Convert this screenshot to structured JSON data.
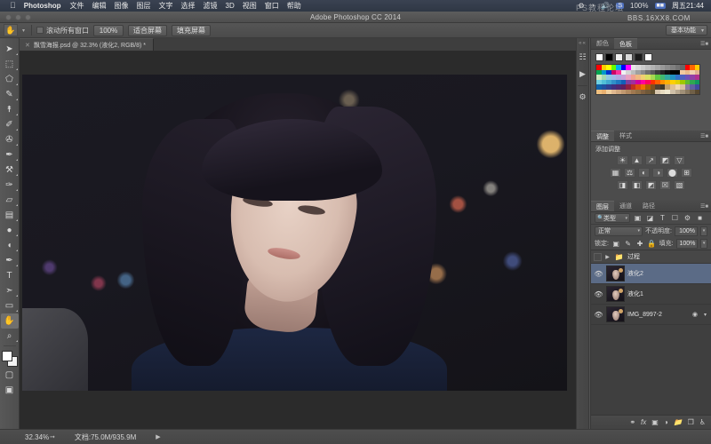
{
  "macbar": {
    "apple_icon": "apple-logo",
    "app_name": "Photoshop",
    "menus": [
      "文件",
      "编辑",
      "图像",
      "图层",
      "文字",
      "选择",
      "滤镜",
      "3D",
      "视图",
      "窗口",
      "帮助"
    ],
    "status_icons": [
      "bluetooth-icon",
      "wifi-icon",
      "volume-icon",
      "scroll-icon"
    ],
    "battery_percent": "100%",
    "battery_icon": "battery-icon",
    "clock": "周五21:44"
  },
  "titlebar": {
    "title": "Adobe Photoshop CC 2014",
    "traffic_lights": [
      "close",
      "minimize",
      "zoom"
    ]
  },
  "options_bar": {
    "tool_icon": "hand-tool-icon",
    "preset_caret": "chevron-down-icon",
    "scroll_all_windows": "滚动所有窗口",
    "buttons": [
      "100%",
      "适合屏幕",
      "填充屏幕"
    ],
    "workspace": "基本功能"
  },
  "document_tab": {
    "label": "飘雪海报.psd @ 32.3% (液化2, RGB/8) *",
    "close_icon": "close-icon"
  },
  "toolbar": {
    "tools": [
      {
        "name": "move-tool",
        "glyph": "➤"
      },
      {
        "name": "marquee-tool",
        "glyph": "⬚"
      },
      {
        "name": "lasso-tool",
        "glyph": "⬠"
      },
      {
        "name": "quick-selection-tool",
        "glyph": "✎"
      },
      {
        "name": "crop-tool",
        "glyph": "⯭"
      },
      {
        "name": "eyedropper-tool",
        "glyph": "✐"
      },
      {
        "name": "healing-brush-tool",
        "glyph": "✇"
      },
      {
        "name": "brush-tool",
        "glyph": "✒"
      },
      {
        "name": "clone-stamp-tool",
        "glyph": "⚒"
      },
      {
        "name": "history-brush-tool",
        "glyph": "✑"
      },
      {
        "name": "eraser-tool",
        "glyph": "▱"
      },
      {
        "name": "gradient-tool",
        "glyph": "▤"
      },
      {
        "name": "blur-tool",
        "glyph": "●"
      },
      {
        "name": "dodge-tool",
        "glyph": "◖"
      },
      {
        "name": "pen-tool",
        "glyph": "✒"
      },
      {
        "name": "type-tool",
        "glyph": "T"
      },
      {
        "name": "path-selection-tool",
        "glyph": "➤"
      },
      {
        "name": "shape-tool",
        "glyph": "▭"
      },
      {
        "name": "hand-tool",
        "glyph": "✋",
        "selected": true
      },
      {
        "name": "zoom-tool",
        "glyph": "⌕"
      }
    ],
    "foreground_color": "#ffffff",
    "background_color": "#f2f2f2",
    "quick_mask_icon": "quick-mask-icon",
    "screen_mode_icon": "screen-mode-icon"
  },
  "color_panel": {
    "tabs": [
      "颜色",
      "色板"
    ],
    "active_tab": "色板",
    "top_swatches": [
      "#ffffff",
      "#000000",
      "#f0f0f0",
      "#d9d9d9",
      "#1a1a1a",
      "#ffffff"
    ],
    "swatches": [
      "#ff0000",
      "#ffcc00",
      "#ffff00",
      "#66ff00",
      "#00b0f0",
      "#0000ff",
      "#ff00ff",
      "#e6e6e6",
      "#d9d9d9",
      "#cccccc",
      "#bfbfbf",
      "#b3b3b3",
      "#a6a6a6",
      "#999999",
      "#8c8c8c",
      "#808080",
      "#737373",
      "#666666",
      "#ff0000",
      "#ff6600",
      "#ffcc00",
      "#00a651",
      "#0099cc",
      "#0033cc",
      "#cc0066",
      "#ff3399",
      "#f2f2f2",
      "#d4d4d4",
      "#bdbdbd",
      "#a0a0a0",
      "#8a8a8a",
      "#6e6e6e",
      "#5a5a5a",
      "#3c3c3c",
      "#262626",
      "#111111",
      "#000000",
      "#000000",
      "#f2c9a0",
      "#e8b98c",
      "#f0d0b0",
      "#e0b090",
      "#cfe8c0",
      "#9fd8b0",
      "#90c8e0",
      "#a0b8e8",
      "#b0a8e0",
      "#c8a0d8",
      "#e8a0c0",
      "#f0a090",
      "#f0b880",
      "#f0d070",
      "#d8e060",
      "#a8d850",
      "#60c840",
      "#40b870",
      "#30a8a0",
      "#2090c0",
      "#3070c8",
      "#5060c0",
      "#7050b8",
      "#9040a8",
      "#b03090",
      "#70d0e0",
      "#50c0d8",
      "#40a8d0",
      "#3090c8",
      "#2078c0",
      "#1060b8",
      "#8040a0",
      "#a030a0",
      "#d000a0",
      "#ff00a0",
      "#ff0060",
      "#ff3000",
      "#ff6000",
      "#ff9000",
      "#ffb000",
      "#ffd000",
      "#e0d000",
      "#a0c800",
      "#60b830",
      "#30a850",
      "#109860",
      "#1060a8",
      "#2050a0",
      "#304090",
      "#403080",
      "#502870",
      "#602060",
      "#902040",
      "#c03020",
      "#e05010",
      "#f07000",
      "#b06000",
      "#805020",
      "#504030",
      "#403828",
      "#c0a070",
      "#e0c090",
      "#f0d8b0",
      "#d8c0a0",
      "#8878a0",
      "#6060a0",
      "#4048a0",
      "#f0c080",
      "#e8b070",
      "#f0d0a0",
      "#e0b890",
      "#d0a880",
      "#c09870",
      "#b08860",
      "#a07850",
      "#907048",
      "#806040",
      "#705838",
      "#605030",
      "#d8c8b0",
      "#e8dcc0",
      "#f0e8d0",
      "#cfc0a8",
      "#b8a890",
      "#a09078",
      "#887860",
      "#706048",
      "#584830"
    ]
  },
  "adjustments_panel": {
    "tabs": [
      "调整",
      "样式"
    ],
    "active_tab": "调整",
    "title": "添加调整",
    "rows": [
      [
        {
          "name": "brightness-contrast-icon",
          "glyph": "☀"
        },
        {
          "name": "levels-icon",
          "glyph": "▲"
        },
        {
          "name": "curves-icon",
          "glyph": "↗"
        },
        {
          "name": "exposure-icon",
          "glyph": "◩"
        },
        {
          "name": "vibrance-icon",
          "glyph": "▽"
        }
      ],
      [
        {
          "name": "hue-saturation-icon",
          "glyph": "▦"
        },
        {
          "name": "color-balance-icon",
          "glyph": "⚖"
        },
        {
          "name": "black-white-icon",
          "glyph": "◐"
        },
        {
          "name": "photo-filter-icon",
          "glyph": "◑"
        },
        {
          "name": "channel-mixer-icon",
          "glyph": "⬤"
        },
        {
          "name": "color-lookup-icon",
          "glyph": "⊞"
        }
      ],
      [
        {
          "name": "invert-icon",
          "glyph": "◨"
        },
        {
          "name": "posterize-icon",
          "glyph": "◧"
        },
        {
          "name": "threshold-icon",
          "glyph": "◩"
        },
        {
          "name": "selective-color-icon",
          "glyph": "☒"
        },
        {
          "name": "gradient-map-icon",
          "glyph": "▧"
        }
      ]
    ]
  },
  "layers_panel": {
    "tabs": [
      "图层",
      "通道",
      "路径"
    ],
    "active_tab": "图层",
    "filter": {
      "kind_label": "类型",
      "icons": [
        "image-filter-icon",
        "adjustment-filter-icon",
        "text-filter-icon",
        "shape-filter-icon",
        "smart-object-filter-icon"
      ],
      "toggle_icon": "filter-toggle-icon"
    },
    "blend_mode": "正常",
    "opacity_label": "不透明度:",
    "opacity_value": "100%",
    "lock_label": "锁定:",
    "lock_icons": [
      "lock-transparent-icon",
      "lock-image-icon",
      "lock-position-icon",
      "lock-all-icon"
    ],
    "fill_label": "填充:",
    "fill_value": "100%",
    "layers": [
      {
        "name": "过程",
        "type": "group",
        "visible": false,
        "expanded": false,
        "selected": false
      },
      {
        "name": "液化2",
        "type": "layer",
        "visible": true,
        "selected": true
      },
      {
        "name": "液化1",
        "type": "layer",
        "visible": true,
        "selected": false
      },
      {
        "name": "IMG_8997-2",
        "type": "layer",
        "visible": true,
        "selected": false,
        "has_fx": true
      }
    ],
    "bottom_buttons": [
      {
        "name": "link-layers-button",
        "glyph": "⚭"
      },
      {
        "name": "layer-style-button",
        "glyph": "fx"
      },
      {
        "name": "layer-mask-button",
        "glyph": "▣"
      },
      {
        "name": "adjustment-layer-button",
        "glyph": "◑"
      },
      {
        "name": "new-group-button",
        "glyph": "▰"
      },
      {
        "name": "new-layer-button",
        "glyph": "❐"
      },
      {
        "name": "delete-layer-button",
        "glyph": "⌧"
      }
    ]
  },
  "rail": {
    "items": [
      {
        "name": "collapse-panels-icon",
        "glyph": "«"
      },
      {
        "name": "history-panel-icon",
        "glyph": "☷"
      },
      {
        "name": "actions-panel-icon",
        "glyph": "▶"
      },
      {
        "name": "properties-panel-icon",
        "glyph": "⚙"
      }
    ]
  },
  "status_bar": {
    "zoom": "32.34%",
    "share_icon": "share-icon",
    "doc_info": "文档:75.0M/935.9M",
    "expand_icon": "expand-arrow-icon"
  },
  "watermarks": {
    "site": "BBS.16XX8.COM",
    "overlay": "PS教程论坛"
  }
}
